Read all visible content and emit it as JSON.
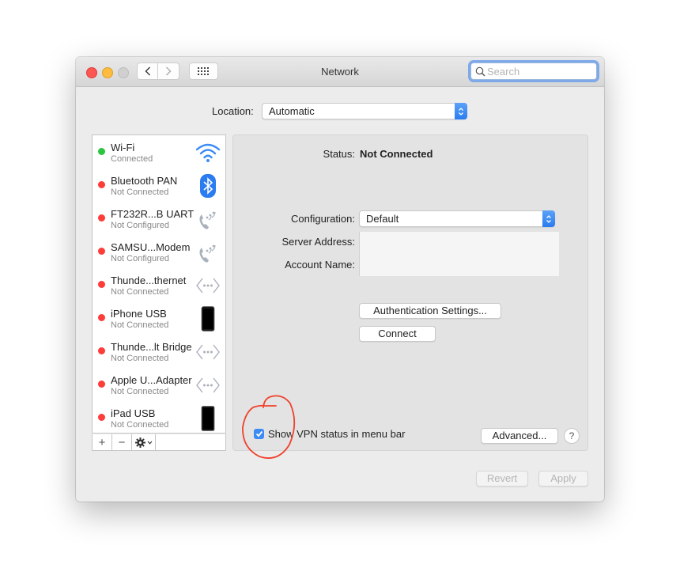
{
  "window": {
    "title": "Network",
    "search": {
      "placeholder": "Search",
      "value": ""
    }
  },
  "location": {
    "label": "Location:",
    "value": "Automatic"
  },
  "services": [
    {
      "name": "Wi-Fi",
      "status": "Connected",
      "status_color": "#2dc43f",
      "icon": "wifi-icon"
    },
    {
      "name": "Bluetooth PAN",
      "status": "Not Connected",
      "status_color": "#fc3d39",
      "icon": "bluetooth-icon"
    },
    {
      "name": "FT232R...B UART",
      "status": "Not Configured",
      "status_color": "#fc3d39",
      "icon": "modem-phone-icon"
    },
    {
      "name": "SAMSU...Modem",
      "status": "Not Configured",
      "status_color": "#fc3d39",
      "icon": "modem-phone-icon"
    },
    {
      "name": "Thunde...thernet",
      "status": "Not Connected",
      "status_color": "#fc3d39",
      "icon": "ethernet-icon"
    },
    {
      "name": "iPhone USB",
      "status": "Not Connected",
      "status_color": "#fc3d39",
      "icon": "iphone-icon"
    },
    {
      "name": "Thunde...lt Bridge",
      "status": "Not Connected",
      "status_color": "#fc3d39",
      "icon": "ethernet-icon"
    },
    {
      "name": "Apple U...Adapter",
      "status": "Not Connected",
      "status_color": "#fc3d39",
      "icon": "ethernet-icon"
    },
    {
      "name": "iPad USB",
      "status": "Not Connected",
      "status_color": "#fc3d39",
      "icon": "ipad-icon"
    }
  ],
  "list_toolbar": {
    "add": "+",
    "remove": "−"
  },
  "detail": {
    "status_label": "Status:",
    "status_value": "Not Connected",
    "configuration_label": "Configuration:",
    "configuration_value": "Default",
    "server_address_label": "Server Address:",
    "server_address_value": "",
    "account_name_label": "Account Name:",
    "account_name_value": "",
    "auth_button": "Authentication Settings...",
    "connect_button": "Connect",
    "show_vpn_label": "Show VPN status in menu bar",
    "show_vpn_checked": true,
    "advanced_button": "Advanced...",
    "help_button": "?"
  },
  "footer": {
    "revert_button": "Revert",
    "apply_button": "Apply"
  },
  "colors": {
    "accent": "#3b8cf5",
    "annotation": "#f0412c"
  }
}
